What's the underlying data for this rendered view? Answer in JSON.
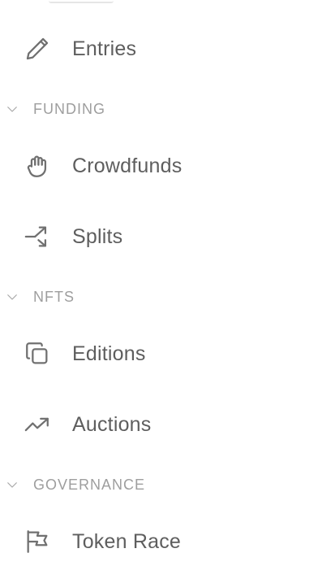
{
  "nav": {
    "entries": {
      "label": "Entries",
      "icon": "pencil-icon"
    },
    "sections": {
      "funding": {
        "label": "FUNDING",
        "items": [
          {
            "label": "Crowdfunds",
            "icon": "hand-icon"
          },
          {
            "label": "Splits",
            "icon": "split-arrow-icon"
          }
        ]
      },
      "nfts": {
        "label": "NFTS",
        "items": [
          {
            "label": "Editions",
            "icon": "copy-icon"
          },
          {
            "label": "Auctions",
            "icon": "trending-up-icon"
          }
        ]
      },
      "governance": {
        "label": "GOVERNANCE",
        "items": [
          {
            "label": "Token Race",
            "icon": "flag-icon"
          }
        ]
      }
    }
  },
  "colors": {
    "text": "#5e5e5e",
    "section": "#9e9e9e",
    "icon": "#707070",
    "background": "#ffffff"
  }
}
